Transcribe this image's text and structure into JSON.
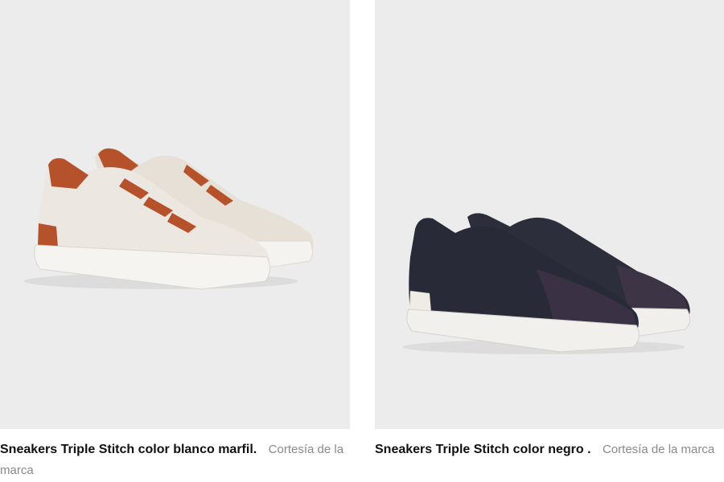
{
  "products": [
    {
      "caption": "Sneakers Triple Stitch color blanco marfil.",
      "credit": "Cortesía de la marca",
      "colors": {
        "upper": "#e9e4dc",
        "accent": "#b5512b",
        "sole": "#f4f3f0",
        "background": "#ececec"
      }
    },
    {
      "caption": "Sneakers Triple Stitch color negro .",
      "credit": "Cortesía de la marca",
      "colors": {
        "upper": "#2b2d3a",
        "accent": "#3a3344",
        "sole": "#f1efec",
        "background": "#ececec"
      }
    }
  ]
}
